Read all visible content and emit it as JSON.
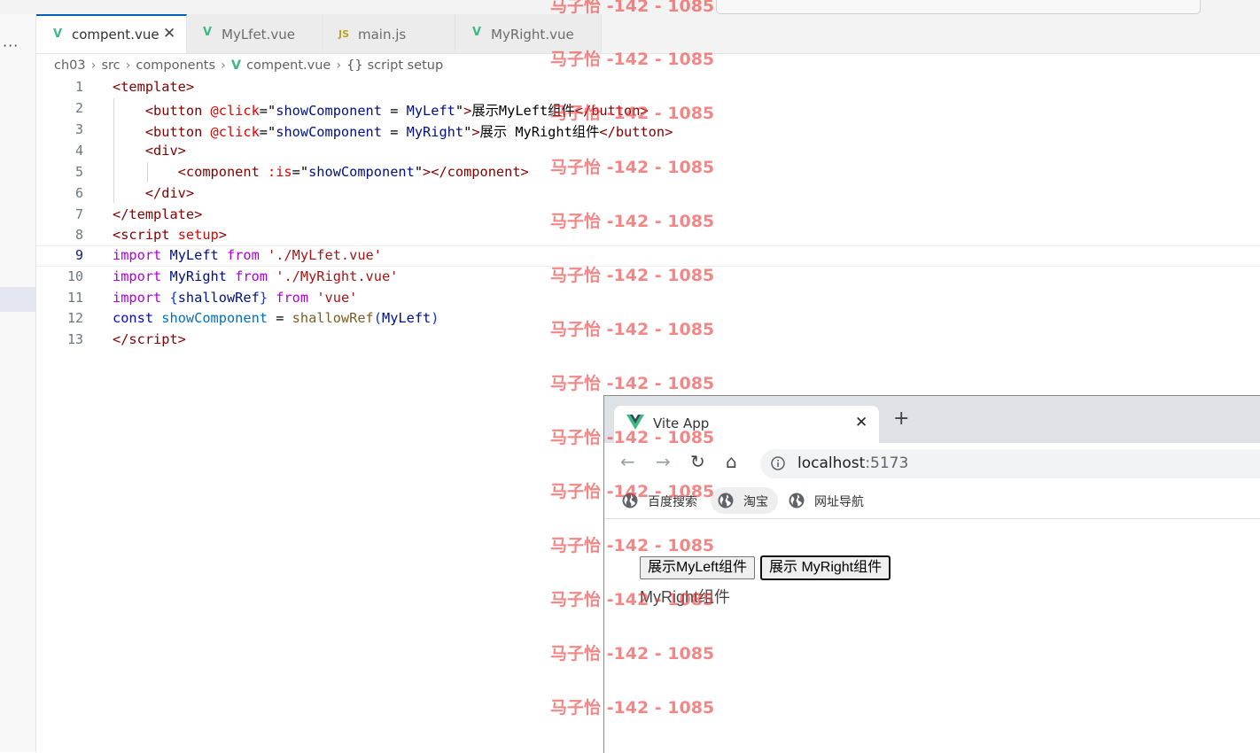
{
  "editor": {
    "tabs": [
      {
        "label": "compent.vue",
        "type": "vue",
        "active": true
      },
      {
        "label": "MyLfet.vue",
        "type": "vue",
        "active": false
      },
      {
        "label": "main.js",
        "type": "js",
        "active": false
      },
      {
        "label": "MyRight.vue",
        "type": "vue",
        "active": false
      }
    ],
    "breadcrumb": [
      "ch03",
      "src",
      "components",
      "compent.vue",
      "script setup"
    ],
    "current_line": 9,
    "line_numbers": [
      "1",
      "2",
      "3",
      "4",
      "5",
      "6",
      "7",
      "8",
      "9",
      "10",
      "11",
      "12",
      "13"
    ]
  },
  "browser": {
    "tab_title": "Vite App",
    "url_host": "localhost",
    "url_port": ":5173",
    "bookmarks": [
      "百度搜索",
      "淘宝",
      "网址导航"
    ],
    "buttons": [
      "展示MyLeft组件",
      "展示 MyRight组件"
    ],
    "rendered_text": "MyRight组件"
  },
  "watermark": "马子怡 -142 - 1085",
  "colors": {
    "vue_green": "#41b883",
    "accent": "#005fb8",
    "watermark_red": "#eb3c3c"
  }
}
